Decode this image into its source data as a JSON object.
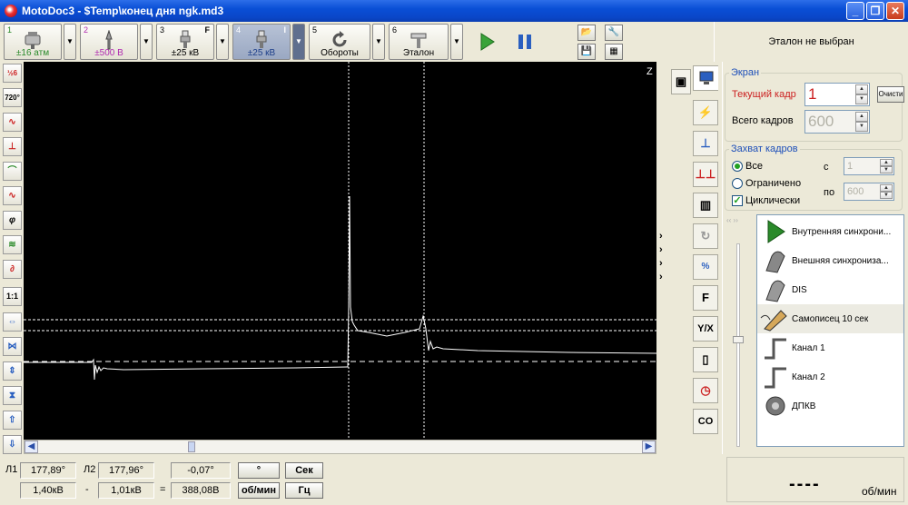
{
  "window": {
    "title": "MotoDoc3 - $Temp\\конец дня ngk.md3"
  },
  "toolbar": {
    "channels": [
      {
        "num": "1",
        "value": "±16 атм",
        "flag": "",
        "color": "#2a8a2a"
      },
      {
        "num": "2",
        "value": "±500 В",
        "flag": "",
        "color": "#b02ab0"
      },
      {
        "num": "3",
        "value": "±25 кВ",
        "flag": "F",
        "color": "#000000"
      },
      {
        "num": "4",
        "value": "±25 кВ",
        "flag": "I",
        "color": "#1d3f8a"
      },
      {
        "num": "5",
        "value": "Обороты",
        "flag": "",
        "color": "#000000"
      },
      {
        "num": "6",
        "value": "Эталон",
        "flag": "",
        "color": "#000000"
      }
    ]
  },
  "etalon": {
    "text": "Эталон не выбран"
  },
  "scope": {
    "corner_label": "Z"
  },
  "screen_group": {
    "legend": "Экран",
    "current_frame_label": "Текущий кадр",
    "current_frame_value": "1",
    "total_frames_label": "Всего кадров",
    "total_frames_value": "600",
    "clear_button": "Очисти"
  },
  "capture_group": {
    "legend": "Захват кадров",
    "options": [
      "Все",
      "Ограничено"
    ],
    "selected": "Все",
    "cyclic_label": "Циклически",
    "cyclic_checked": true,
    "from_label": "с",
    "from_value": "1",
    "to_label": "по",
    "to_value": "600"
  },
  "sync_list": [
    {
      "label": "Внутренняя синхрони...",
      "icon": "play-triangle-icon"
    },
    {
      "label": "Внешняя синхрониза...",
      "icon": "probe-clip-icon"
    },
    {
      "label": "DIS",
      "icon": "dis-probe-icon"
    },
    {
      "label": "Самописец 10 сек",
      "icon": "recorder-pen-icon",
      "selected": true
    },
    {
      "label": "Канал 1",
      "icon": "channel-edge-icon"
    },
    {
      "label": "Канал 2",
      "icon": "channel-edge-icon"
    },
    {
      "label": "ДПКВ",
      "icon": "crank-sensor-icon"
    }
  ],
  "bottom": {
    "l1_label": "Л1",
    "l1_value": "177,89°",
    "l2_label": "Л2",
    "l2_value": "177,96°",
    "delta_angle": "-0,07°",
    "v1": "1,40кВ",
    "minus": "-",
    "v2": "1,01кВ",
    "eq": "=",
    "delta_v": "388,08В",
    "deg_button": "°",
    "sec_button": "Сек",
    "rpm_button": "об/мин",
    "hz_button": "Гц",
    "rpm_display": "----",
    "rpm_unit": "об/мин"
  },
  "left_tools": [
    "¹⁄₂₆",
    "720°",
    "swap",
    "cursor",
    "trig",
    "sine",
    "phi",
    "wave",
    "ovl",
    "1:1",
    "h-exp",
    "h-cmp",
    "v-exp",
    "v-cmp",
    "up",
    "down"
  ],
  "right_tabs": [
    "F",
    "Y/X",
    "CO"
  ]
}
